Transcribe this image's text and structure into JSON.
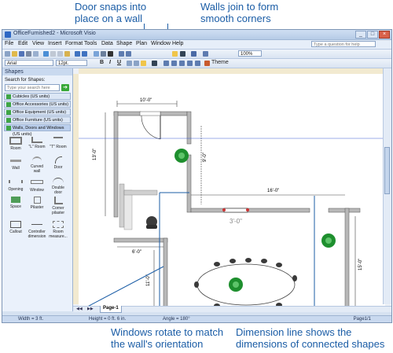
{
  "callouts": {
    "door": [
      "Door snaps into",
      "place on a wall"
    ],
    "walls": [
      "Walls join to form",
      "smooth corners"
    ],
    "windows": [
      "Windows rotate to match",
      "the wall's orientation"
    ],
    "dimension": [
      "Dimension line shows the",
      "dimensions of connected shapes"
    ]
  },
  "window": {
    "title": "OfficeFurnished2 - Microsoft Visio"
  },
  "menu": [
    "File",
    "Edit",
    "View",
    "Insert",
    "Format",
    "Tools",
    "Data",
    "Shape",
    "Plan",
    "Window",
    "Help"
  ],
  "help_placeholder": "Type a question for help",
  "toolbar": {
    "zoom": "100%",
    "font": "Arial",
    "size": "12pt.",
    "theme": "Theme"
  },
  "shapes_panel": {
    "header": "Shapes",
    "search_label": "Search for Shapes:",
    "search_placeholder": "Type your search here",
    "stencils": [
      "Cubicles (US units)",
      "Office Accessories (US units)",
      "Office Equipment (US units)",
      "Office Furniture (US units)",
      "Walls, Doors and Windows (US units)"
    ],
    "shapes": [
      "Room",
      "\"L\" Room",
      "\"T\" Room",
      "Wall",
      "Curved wall",
      "Door",
      "Opening",
      "Window",
      "Double door",
      "Space",
      "Pilaster",
      "Corner pilaster",
      "Callout",
      "Controller dimension",
      "Room measure..."
    ]
  },
  "drawing": {
    "dim_top": "10'-0\"",
    "dim_left": "13'-0\"",
    "dim_wall": "9'-0\"",
    "dim_right_top": "16'-0\"",
    "dim_bottom": "6'-0\"",
    "dim_right_side": "15'-0\"",
    "dim_lower_left": "11'-0\"",
    "window_label": "3'-0\""
  },
  "page_tab": "Page-1",
  "status": {
    "width": "Width = 3 ft.",
    "height": "Height = 0 ft. 6 in.",
    "angle": "Angle = 180°",
    "page": "Page1/1"
  },
  "colors": {
    "callout": "#1b5da6",
    "wall": "#a0a0a0",
    "plant": "#1e8f2e",
    "stencil_check": "#3fa645"
  }
}
